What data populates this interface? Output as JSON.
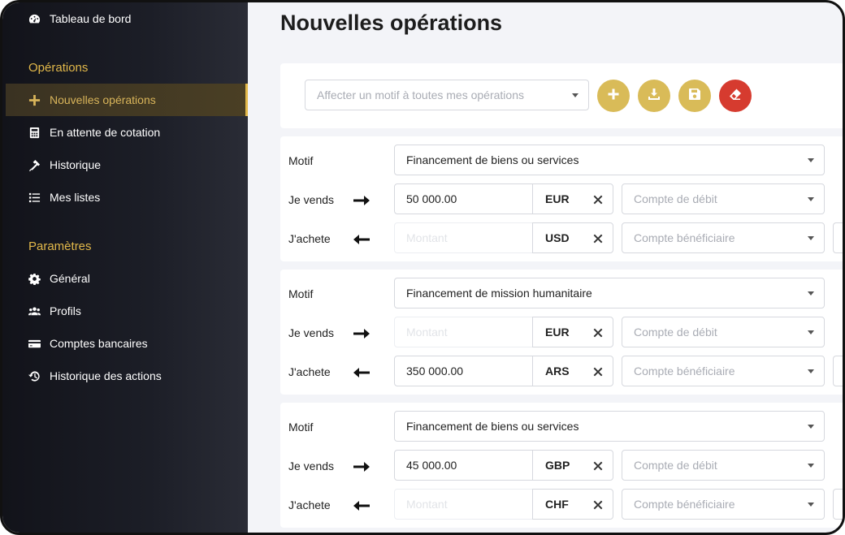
{
  "sidebar": {
    "top_item": {
      "label": "Tableau de bord",
      "icon": "dashboard-icon"
    },
    "sections": [
      {
        "title": "Opérations",
        "items": [
          {
            "label": "Nouvelles opérations",
            "icon": "plus-icon",
            "active": true
          },
          {
            "label": "En attente de cotation",
            "icon": "calculator-icon"
          },
          {
            "label": "Historique",
            "icon": "gavel-icon"
          },
          {
            "label": "Mes listes",
            "icon": "list-icon"
          }
        ]
      },
      {
        "title": "Paramètres",
        "items": [
          {
            "label": "Général",
            "icon": "gear-icon"
          },
          {
            "label": "Profils",
            "icon": "users-icon"
          },
          {
            "label": "Comptes bancaires",
            "icon": "credit-card-icon"
          },
          {
            "label": "Historique des actions",
            "icon": "history-icon"
          }
        ]
      }
    ]
  },
  "main": {
    "title": "Nouvelles opérations",
    "toolbar": {
      "motif_placeholder": "Affecter un motif à toutes mes opérations",
      "buttons": [
        {
          "name": "add",
          "icon": "plus-icon",
          "color": "#d9bb58"
        },
        {
          "name": "download",
          "icon": "download-icon",
          "color": "#d9bb58"
        },
        {
          "name": "save",
          "icon": "save-icon",
          "color": "#d9bb58"
        },
        {
          "name": "clear",
          "icon": "eraser-icon",
          "color": "#d63b2f"
        }
      ]
    },
    "labels": {
      "motif": "Motif",
      "sell": "Je vends",
      "buy": "J'achete",
      "amount_placeholder": "Montant",
      "debit_placeholder": "Compte de débit",
      "beneficiary_placeholder": "Compte bénéficiaire"
    },
    "operations": [
      {
        "motif": "Financement de biens ou services",
        "sell_amount": "50 000.00",
        "sell_currency": "EUR",
        "buy_amount": "",
        "buy_currency": "USD"
      },
      {
        "motif": "Financement de mission humanitaire",
        "sell_amount": "",
        "sell_currency": "EUR",
        "buy_amount": "350 000.00",
        "buy_currency": "ARS"
      },
      {
        "motif": "Financement de biens ou services",
        "sell_amount": "45 000.00",
        "sell_currency": "GBP",
        "buy_amount": "",
        "buy_currency": "CHF"
      }
    ]
  },
  "colors": {
    "accent": "#e2b84a",
    "button_gold": "#d9bb58",
    "button_red": "#d63b2f",
    "sidebar_bg": "#1c1e27"
  }
}
